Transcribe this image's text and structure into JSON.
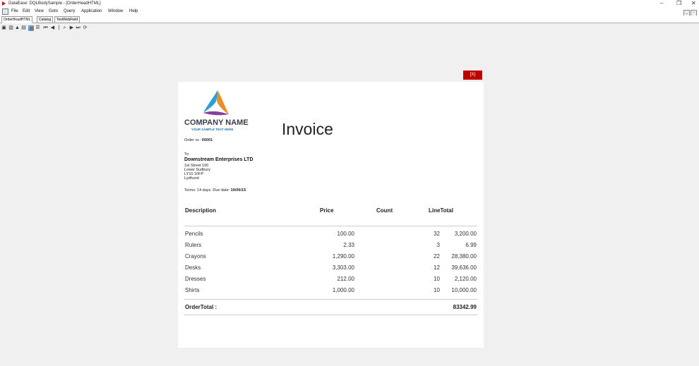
{
  "window": {
    "title": "DataEase: DQLBodySample - [OrderHeadHTML]",
    "controls": [
      "–",
      "❐",
      "✕"
    ]
  },
  "menu": [
    "File",
    "Edit",
    "View",
    "Goto",
    "Query",
    "Application",
    "Window",
    "Help"
  ],
  "tabs": [
    {
      "label": "OrderHeadHTML",
      "active": true
    },
    {
      "label": "Catalog",
      "active": false
    },
    {
      "label": "TestWebField",
      "active": false
    }
  ],
  "close_button": "[X]",
  "invoice": {
    "company_name": "COMPANY NAME",
    "tagline": "YOUR SAMPLE TEXT HERE",
    "title": "Invoice",
    "order_label": "Order nr.: ",
    "order_no": "00001",
    "to_label": "To:",
    "customer": "Downstream Enterprises LTD",
    "address": [
      "1st Street 100",
      "Lower Sudbury",
      "LY10 10FP",
      "Lydhurst"
    ],
    "terms_prefix": "Terms: 14 days. Due date: ",
    "due_date": "19/06/15",
    "headers": {
      "description": "Description",
      "price": "Price",
      "count": "Count",
      "line_total": "LineTotal"
    },
    "items": [
      {
        "description": "Pencils",
        "price": "100.00",
        "count": "32",
        "line_total": "3,200.00"
      },
      {
        "description": "Rulers",
        "price": "2.33",
        "count": "3",
        "line_total": "6.99"
      },
      {
        "description": "Crayons",
        "price": "1,290.00",
        "count": "22",
        "line_total": "28,380.00"
      },
      {
        "description": "Desks",
        "price": "3,303.00",
        "count": "12",
        "line_total": "39,636.00"
      },
      {
        "description": "Dresses",
        "price": "212.00",
        "count": "10",
        "line_total": "2,120.00"
      },
      {
        "description": "Shirts",
        "price": "1,000.00",
        "count": "10",
        "line_total": "10,000.00"
      }
    ],
    "order_total_label": "OrderTotal :",
    "order_total": "83342.99"
  }
}
